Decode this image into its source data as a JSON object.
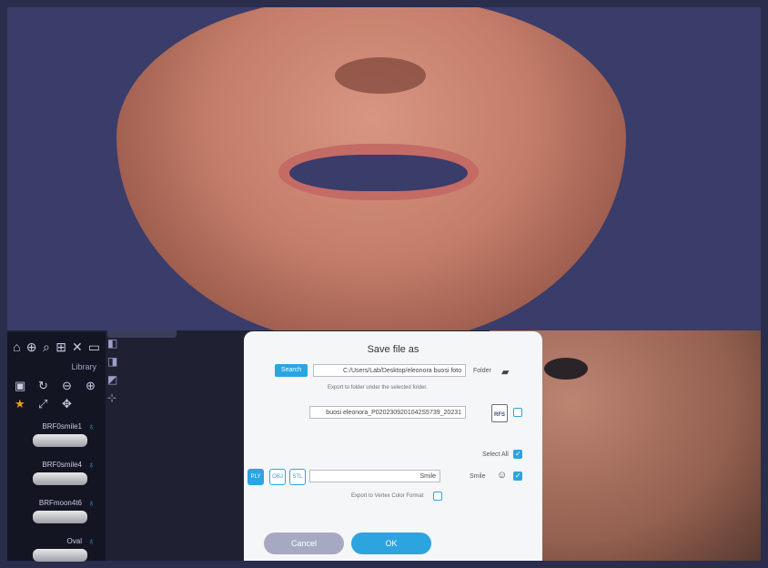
{
  "dialog": {
    "title": "Save file as",
    "folder_label": "Folder",
    "folder_path": "C:/Users/Lab/Desktop/eleonora buosi foto",
    "search_label": "Search",
    "export_hint": "Export to folder under the selected folder.",
    "filename": "buosi eleonora_P0202309201042S5739_20231",
    "select_all_label": "Select All",
    "smile_label": "Smile",
    "smile_value": "Smile",
    "vertex_label": "Export to Vertex Color Format",
    "ok_label": "OK",
    "cancel_label": "Cancel",
    "rfs_label": "RFS",
    "formats": [
      "STL",
      "OBJ",
      "PLY"
    ]
  },
  "sidebar": {
    "library_label": "Library",
    "items": [
      {
        "name": "BRF0smile1"
      },
      {
        "name": "BRF0smile4"
      },
      {
        "name": "BRFmoon4t6"
      },
      {
        "name": "Oval"
      }
    ]
  },
  "colors": {
    "accent": "#2ca4e0",
    "star": "#e3a21a"
  }
}
